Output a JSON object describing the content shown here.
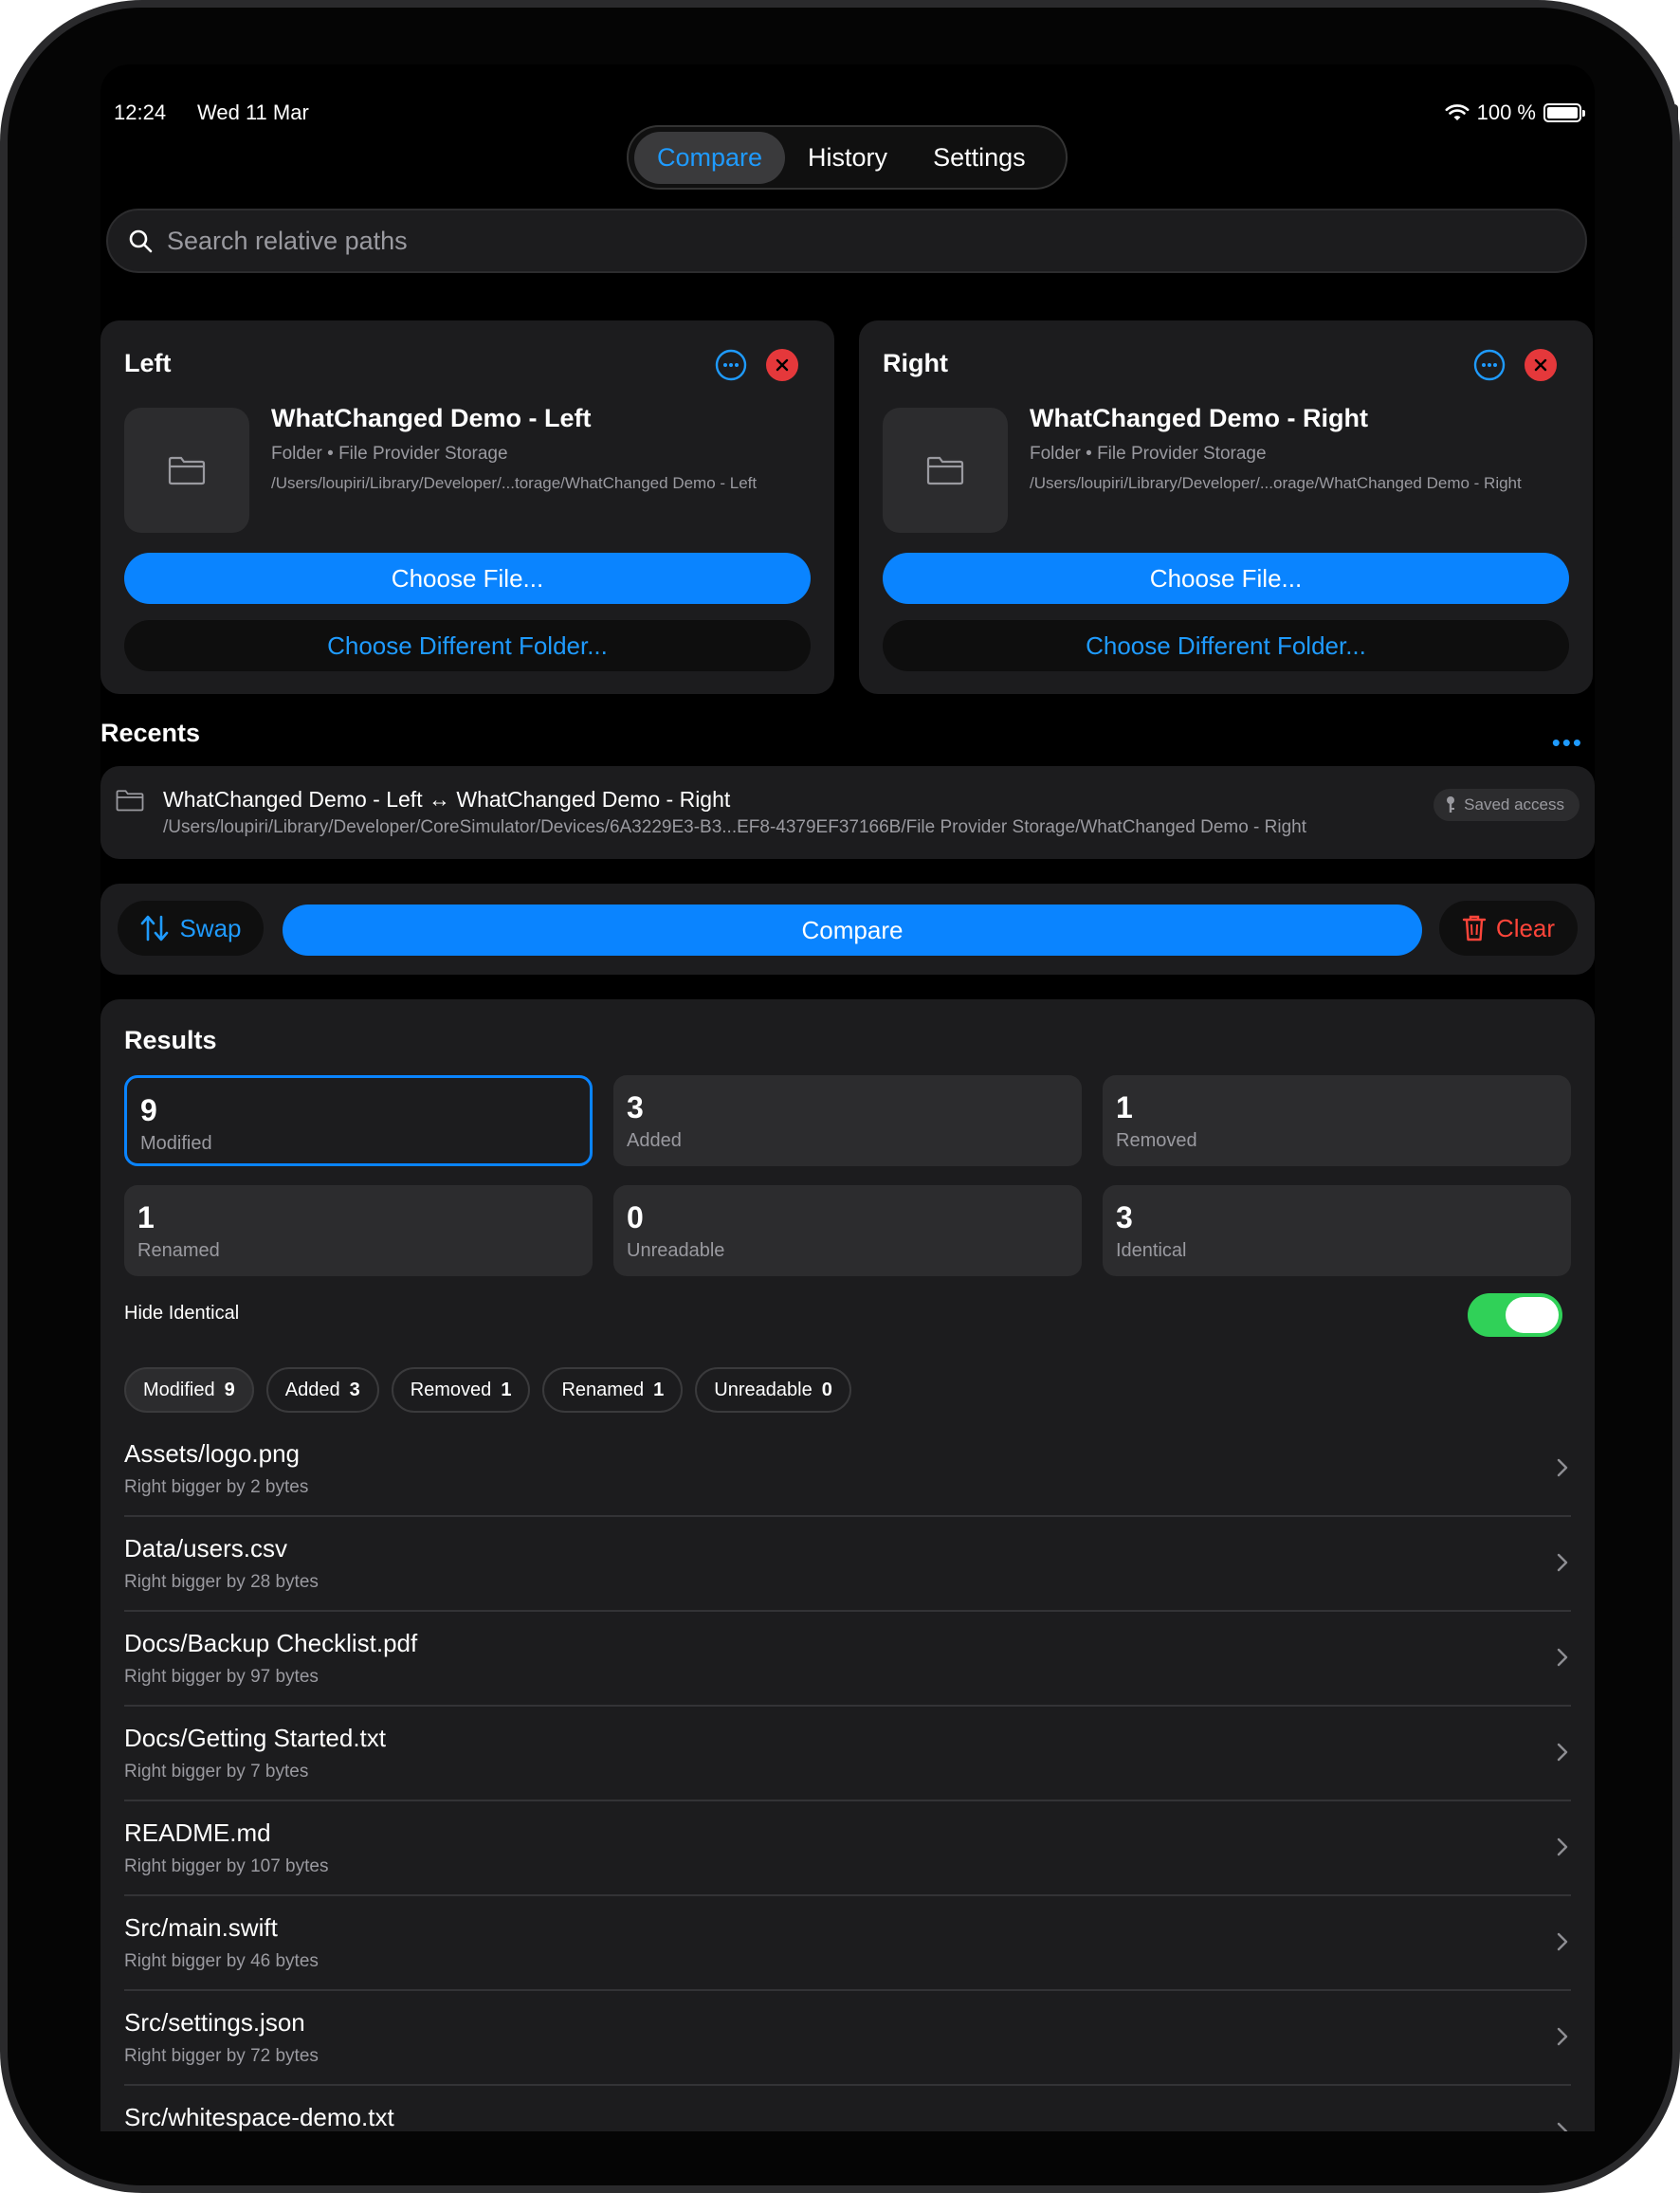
{
  "status": {
    "time": "12:24",
    "date": "Wed 11 Mar",
    "battery": "100 %"
  },
  "tabs": [
    "Compare",
    "History",
    "Settings"
  ],
  "search": {
    "placeholder": "Search relative paths"
  },
  "left": {
    "title": "Left",
    "name": "WhatChanged Demo - Left",
    "meta": "Folder • File Provider Storage",
    "path": "/Users/loupiri/Library/Developer/...torage/WhatChanged Demo - Left",
    "choose_file": "Choose File...",
    "choose_folder": "Choose Different Folder..."
  },
  "right": {
    "title": "Right",
    "name": "WhatChanged Demo - Right",
    "meta": "Folder • File Provider Storage",
    "path": "/Users/loupiri/Library/Developer/...orage/WhatChanged Demo - Right",
    "choose_file": "Choose File...",
    "choose_folder": "Choose Different Folder..."
  },
  "recents": {
    "title": "Recents",
    "item": {
      "name": "WhatChanged Demo - Left ↔ WhatChanged Demo - Right",
      "path": "/Users/loupiri/Library/Developer/CoreSimulator/Devices/6A3229E3-B3...EF8-4379EF37166B/File Provider Storage/WhatChanged Demo - Right",
      "badge": "Saved access"
    }
  },
  "actions": {
    "swap": "Swap",
    "compare": "Compare",
    "clear": "Clear"
  },
  "results": {
    "title": "Results",
    "stats": [
      {
        "num": "9",
        "label": "Modified"
      },
      {
        "num": "3",
        "label": "Added"
      },
      {
        "num": "1",
        "label": "Removed"
      },
      {
        "num": "1",
        "label": "Renamed"
      },
      {
        "num": "0",
        "label": "Unreadable"
      },
      {
        "num": "3",
        "label": "Identical"
      }
    ],
    "hide_identical": "Hide Identical",
    "chips": [
      {
        "label": "Modified",
        "count": "9"
      },
      {
        "label": "Added",
        "count": "3"
      },
      {
        "label": "Removed",
        "count": "1"
      },
      {
        "label": "Renamed",
        "count": "1"
      },
      {
        "label": "Unreadable",
        "count": "0"
      }
    ],
    "files": [
      {
        "name": "Assets/logo.png",
        "desc": "Right bigger by 2 bytes"
      },
      {
        "name": "Data/users.csv",
        "desc": "Right bigger by 28 bytes"
      },
      {
        "name": "Docs/Backup Checklist.pdf",
        "desc": "Right bigger by 97 bytes"
      },
      {
        "name": "Docs/Getting Started.txt",
        "desc": "Right bigger by 7 bytes"
      },
      {
        "name": "README.md",
        "desc": "Right bigger by 107 bytes"
      },
      {
        "name": "Src/main.swift",
        "desc": "Right bigger by 46 bytes"
      },
      {
        "name": "Src/settings.json",
        "desc": "Right bigger by 72 bytes"
      },
      {
        "name": "Src/whitespace-demo.txt",
        "desc": ""
      }
    ]
  },
  "colors": {
    "accent": "#0a84ff",
    "destructive": "#ff453a",
    "toggle_on": "#30d158"
  }
}
